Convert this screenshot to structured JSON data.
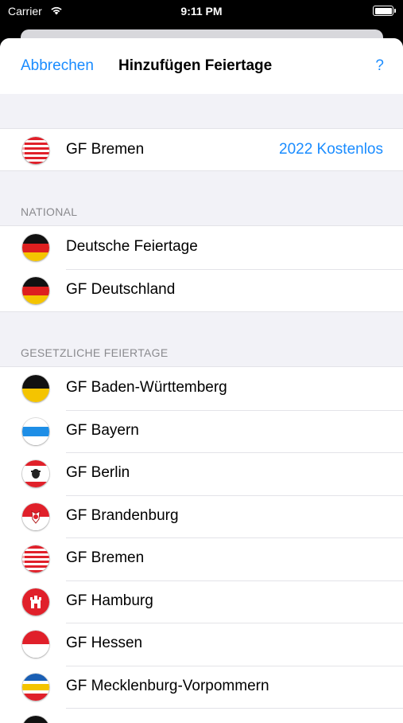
{
  "status_bar": {
    "carrier": "Carrier",
    "time": "9:11 PM"
  },
  "nav": {
    "cancel_label": "Abbrechen",
    "title": "Hinzufügen Feiertage",
    "help_label": "?"
  },
  "featured": {
    "icon": "bremen-flag",
    "label": "GF Bremen",
    "price": "2022 Kostenlos"
  },
  "sections": {
    "national": {
      "header": "NATIONAL",
      "items": [
        {
          "icon": "germany-flag",
          "label": "Deutsche Feiertage"
        },
        {
          "icon": "germany-flag",
          "label": "GF Deutschland"
        }
      ]
    },
    "gesetzlich": {
      "header": "GESETZLICHE FEIERTAGE",
      "items": [
        {
          "icon": "baden-wuerttemberg-flag",
          "label": "GF Baden-Württemberg"
        },
        {
          "icon": "bayern-flag",
          "label": "GF Bayern"
        },
        {
          "icon": "berlin-flag",
          "label": "GF Berlin"
        },
        {
          "icon": "brandenburg-flag",
          "label": "GF Brandenburg"
        },
        {
          "icon": "bremen-flag",
          "label": "GF Bremen"
        },
        {
          "icon": "hamburg-flag",
          "label": "GF Hamburg"
        },
        {
          "icon": "hessen-flag",
          "label": "GF Hessen"
        },
        {
          "icon": "mecklenburg-vorpommern-flag",
          "label": "GF Mecklenburg-Vorpommern"
        }
      ]
    }
  },
  "colors": {
    "accent": "#1a8cff",
    "background": "#f2f2f7",
    "separator": "#e3e3e8"
  }
}
